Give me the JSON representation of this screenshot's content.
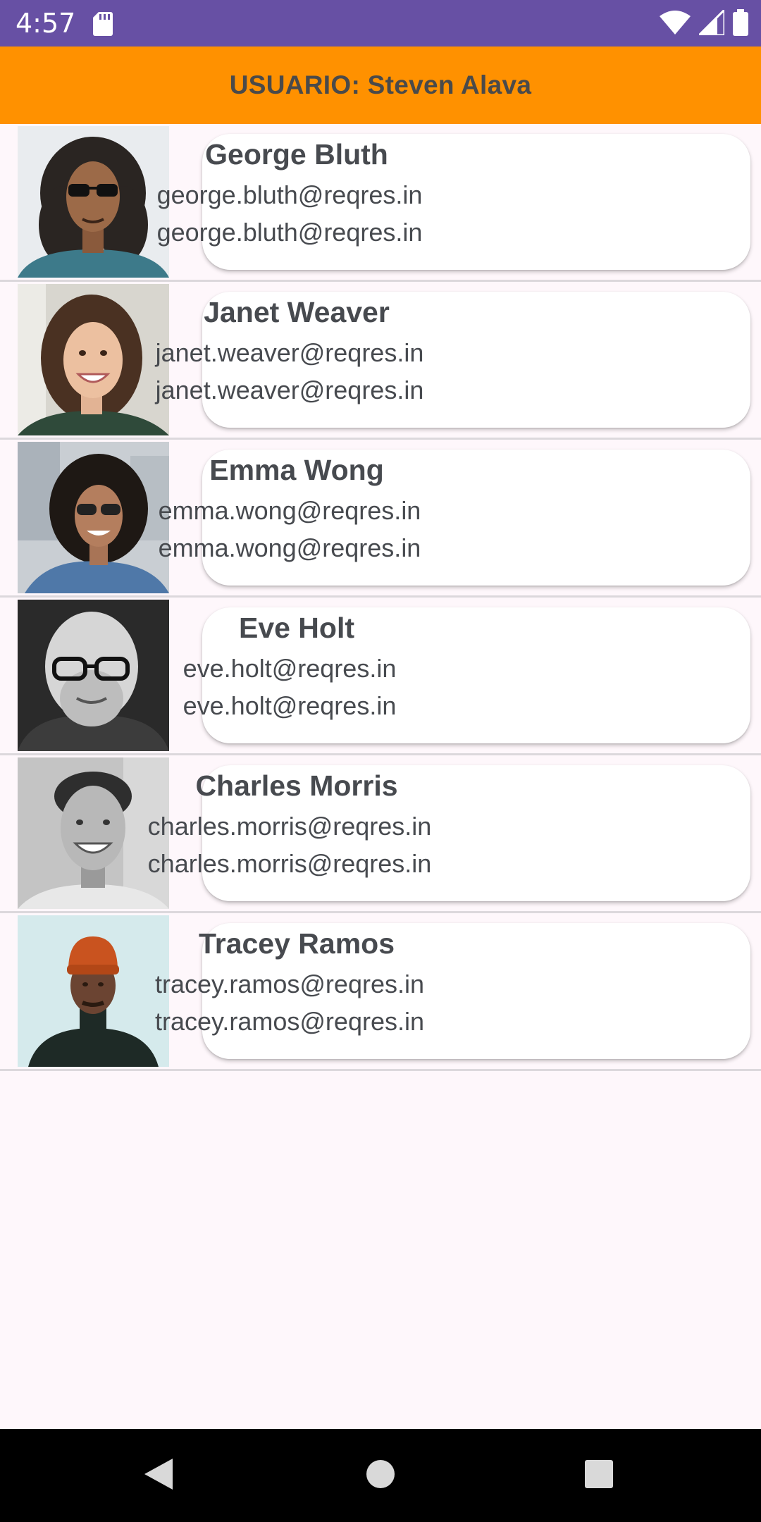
{
  "status_bar": {
    "time": "4:57",
    "background": "#6750a4",
    "icons": [
      "sd-card-icon",
      "wifi-icon",
      "signal-icon",
      "battery-icon"
    ]
  },
  "app_bar": {
    "title": "USUARIO: Steven Alava",
    "background": "#ff9100"
  },
  "users": [
    {
      "name": "George Bluth",
      "email": "george.bluth@reqres.in",
      "email_secondary": "george.bluth@reqres.in"
    },
    {
      "name": "Janet Weaver",
      "email": "janet.weaver@reqres.in",
      "email_secondary": "janet.weaver@reqres.in"
    },
    {
      "name": "Emma Wong",
      "email": "emma.wong@reqres.in",
      "email_secondary": "emma.wong@reqres.in"
    },
    {
      "name": "Eve Holt",
      "email": "eve.holt@reqres.in",
      "email_secondary": "eve.holt@reqres.in"
    },
    {
      "name": "Charles Morris",
      "email": "charles.morris@reqres.in",
      "email_secondary": "charles.morris@reqres.in"
    },
    {
      "name": "Tracey Ramos",
      "email": "tracey.ramos@reqres.in",
      "email_secondary": "tracey.ramos@reqres.in"
    }
  ],
  "nav_bar": {
    "buttons": [
      "back-icon",
      "home-icon",
      "recents-icon"
    ]
  }
}
